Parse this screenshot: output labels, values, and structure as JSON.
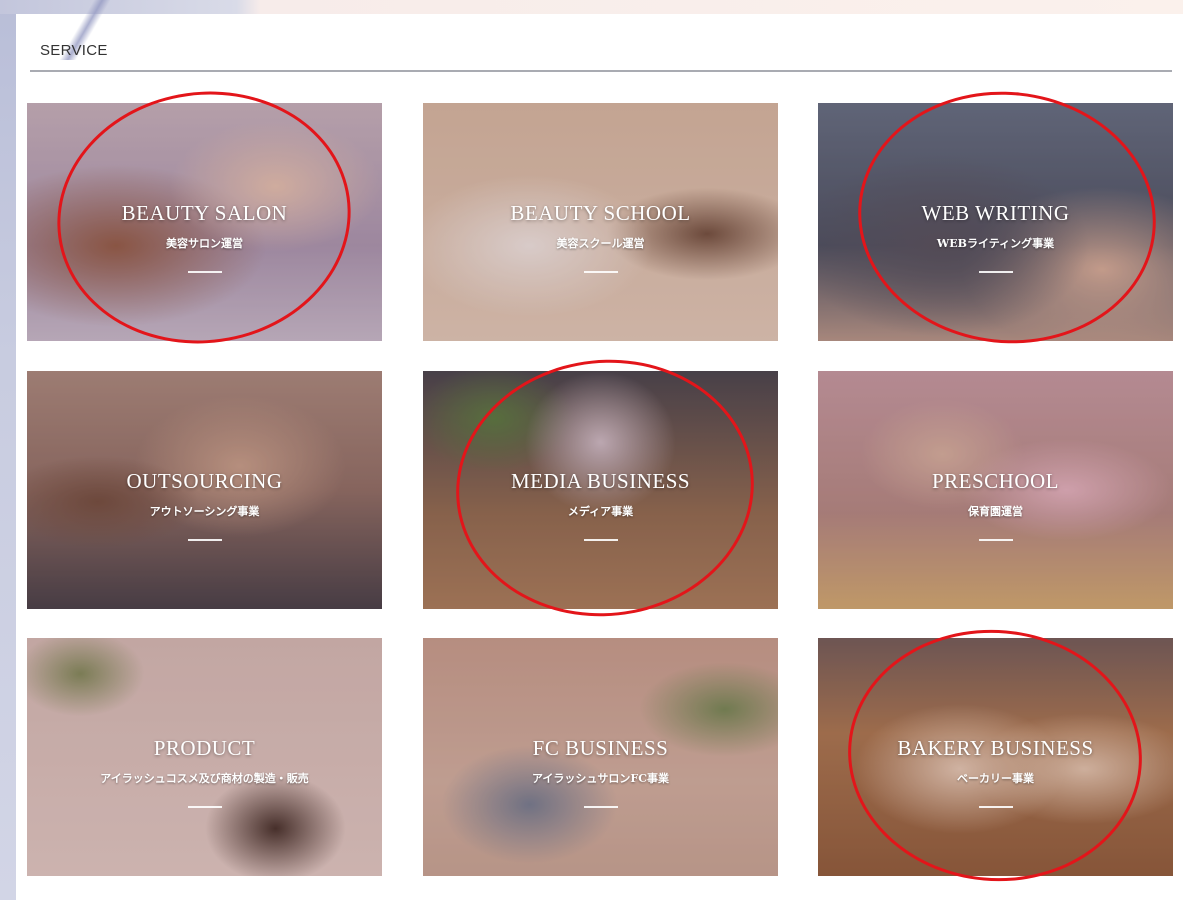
{
  "section": {
    "title": "SERVICE"
  },
  "cards": [
    {
      "title": "BEAUTY SALON",
      "subtitle": "美容サロン運営",
      "highlighted": true
    },
    {
      "title": "BEAUTY SCHOOL",
      "subtitle": "美容スクール運営",
      "highlighted": false
    },
    {
      "title": "WEB WRITING",
      "subtitle": "WEBライティング事業",
      "highlighted": true
    },
    {
      "title": "OUTSOURCING",
      "subtitle": "アウトソーシング事業",
      "highlighted": false
    },
    {
      "title": "MEDIA BUSINESS",
      "subtitle": "メディア事業",
      "highlighted": true
    },
    {
      "title": "PRESCHOOL",
      "subtitle": "保育園運営",
      "highlighted": false
    },
    {
      "title": "PRODUCT",
      "subtitle": "アイラッシュコスメ及び商材の製造・販売",
      "highlighted": false
    },
    {
      "title": "FC BUSINESS",
      "subtitle": "アイラッシュサロンFC事業",
      "highlighted": false
    },
    {
      "title": "BAKERY BUSINESS",
      "subtitle": "ベーカリー事業",
      "highlighted": true
    }
  ],
  "colors": {
    "highlight": "#e3151a",
    "rule": "#a9abb2"
  }
}
